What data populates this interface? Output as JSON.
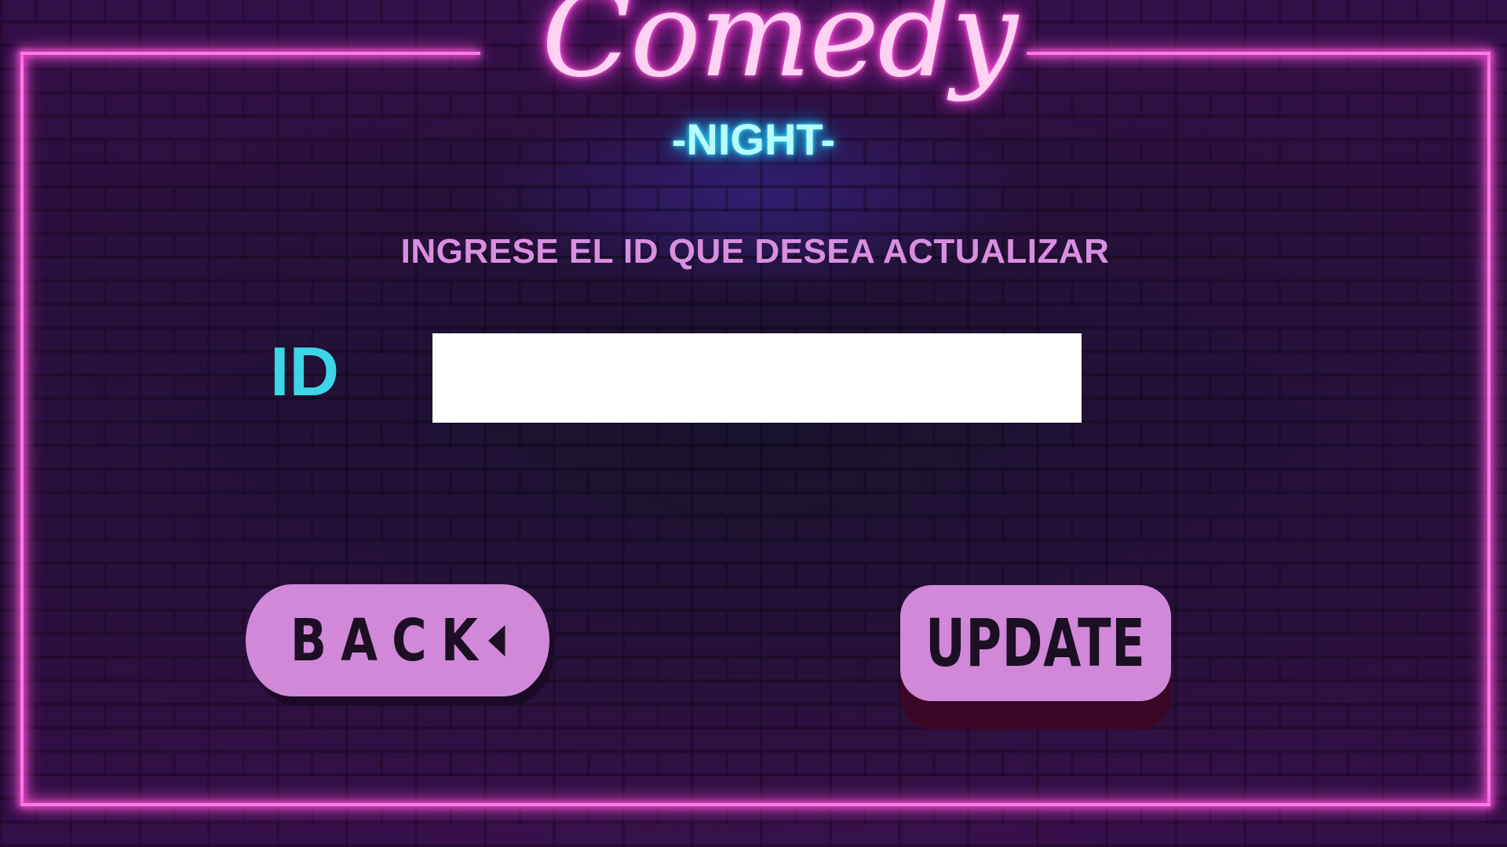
{
  "logo": {
    "comedy": "Comedy",
    "night": "-NIGHT-"
  },
  "form": {
    "heading": "INGRESE EL ID QUE DESEA ACTUALIZAR",
    "id_label": "ID",
    "id_value": "",
    "id_placeholder": ""
  },
  "buttons": {
    "back_label": "BACK",
    "update_label": "UPDATE"
  },
  "colors": {
    "neon_pink": "#ff7ae6",
    "neon_cyan": "#2ee9ff",
    "heading": "#d98ee0",
    "id_label": "#3cd6e6",
    "button_fill": "#d188d8",
    "button_text": "#1c0f24",
    "update_shadow": "#3a0625"
  },
  "icons": {
    "back_arrow": "triangle-left-icon"
  }
}
